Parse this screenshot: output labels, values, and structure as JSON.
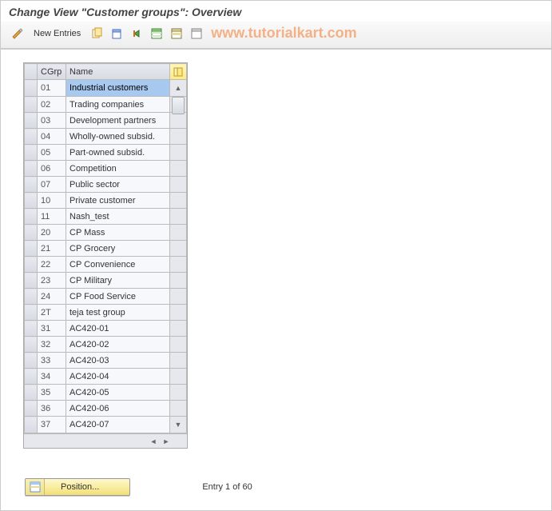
{
  "title": "Change View \"Customer groups\": Overview",
  "toolbar": {
    "new_entries_label": "New Entries"
  },
  "watermark": "www.tutorialkart.com",
  "table": {
    "columns": {
      "cgrp": "CGrp",
      "name": "Name"
    },
    "rows": [
      {
        "cgrp": "01",
        "name": "Industrial customers",
        "selected": true
      },
      {
        "cgrp": "02",
        "name": "Trading companies"
      },
      {
        "cgrp": "03",
        "name": "Development partners"
      },
      {
        "cgrp": "04",
        "name": "Wholly-owned subsid."
      },
      {
        "cgrp": "05",
        "name": "Part-owned subsid."
      },
      {
        "cgrp": "06",
        "name": "Competition"
      },
      {
        "cgrp": "07",
        "name": "Public sector"
      },
      {
        "cgrp": "10",
        "name": "Private customer"
      },
      {
        "cgrp": "11",
        "name": "Nash_test"
      },
      {
        "cgrp": "20",
        "name": "CP Mass"
      },
      {
        "cgrp": "21",
        "name": "CP Grocery"
      },
      {
        "cgrp": "22",
        "name": "CP Convenience"
      },
      {
        "cgrp": "23",
        "name": "CP Military"
      },
      {
        "cgrp": "24",
        "name": "CP Food Service"
      },
      {
        "cgrp": "2T",
        "name": "teja test group"
      },
      {
        "cgrp": "31",
        "name": "AC420-01"
      },
      {
        "cgrp": "32",
        "name": "AC420-02"
      },
      {
        "cgrp": "33",
        "name": "AC420-03"
      },
      {
        "cgrp": "34",
        "name": "AC420-04"
      },
      {
        "cgrp": "35",
        "name": "AC420-05"
      },
      {
        "cgrp": "36",
        "name": "AC420-06"
      },
      {
        "cgrp": "37",
        "name": "AC420-07"
      }
    ]
  },
  "footer": {
    "position_label": "Position...",
    "entry_text": "Entry 1 of 60"
  }
}
